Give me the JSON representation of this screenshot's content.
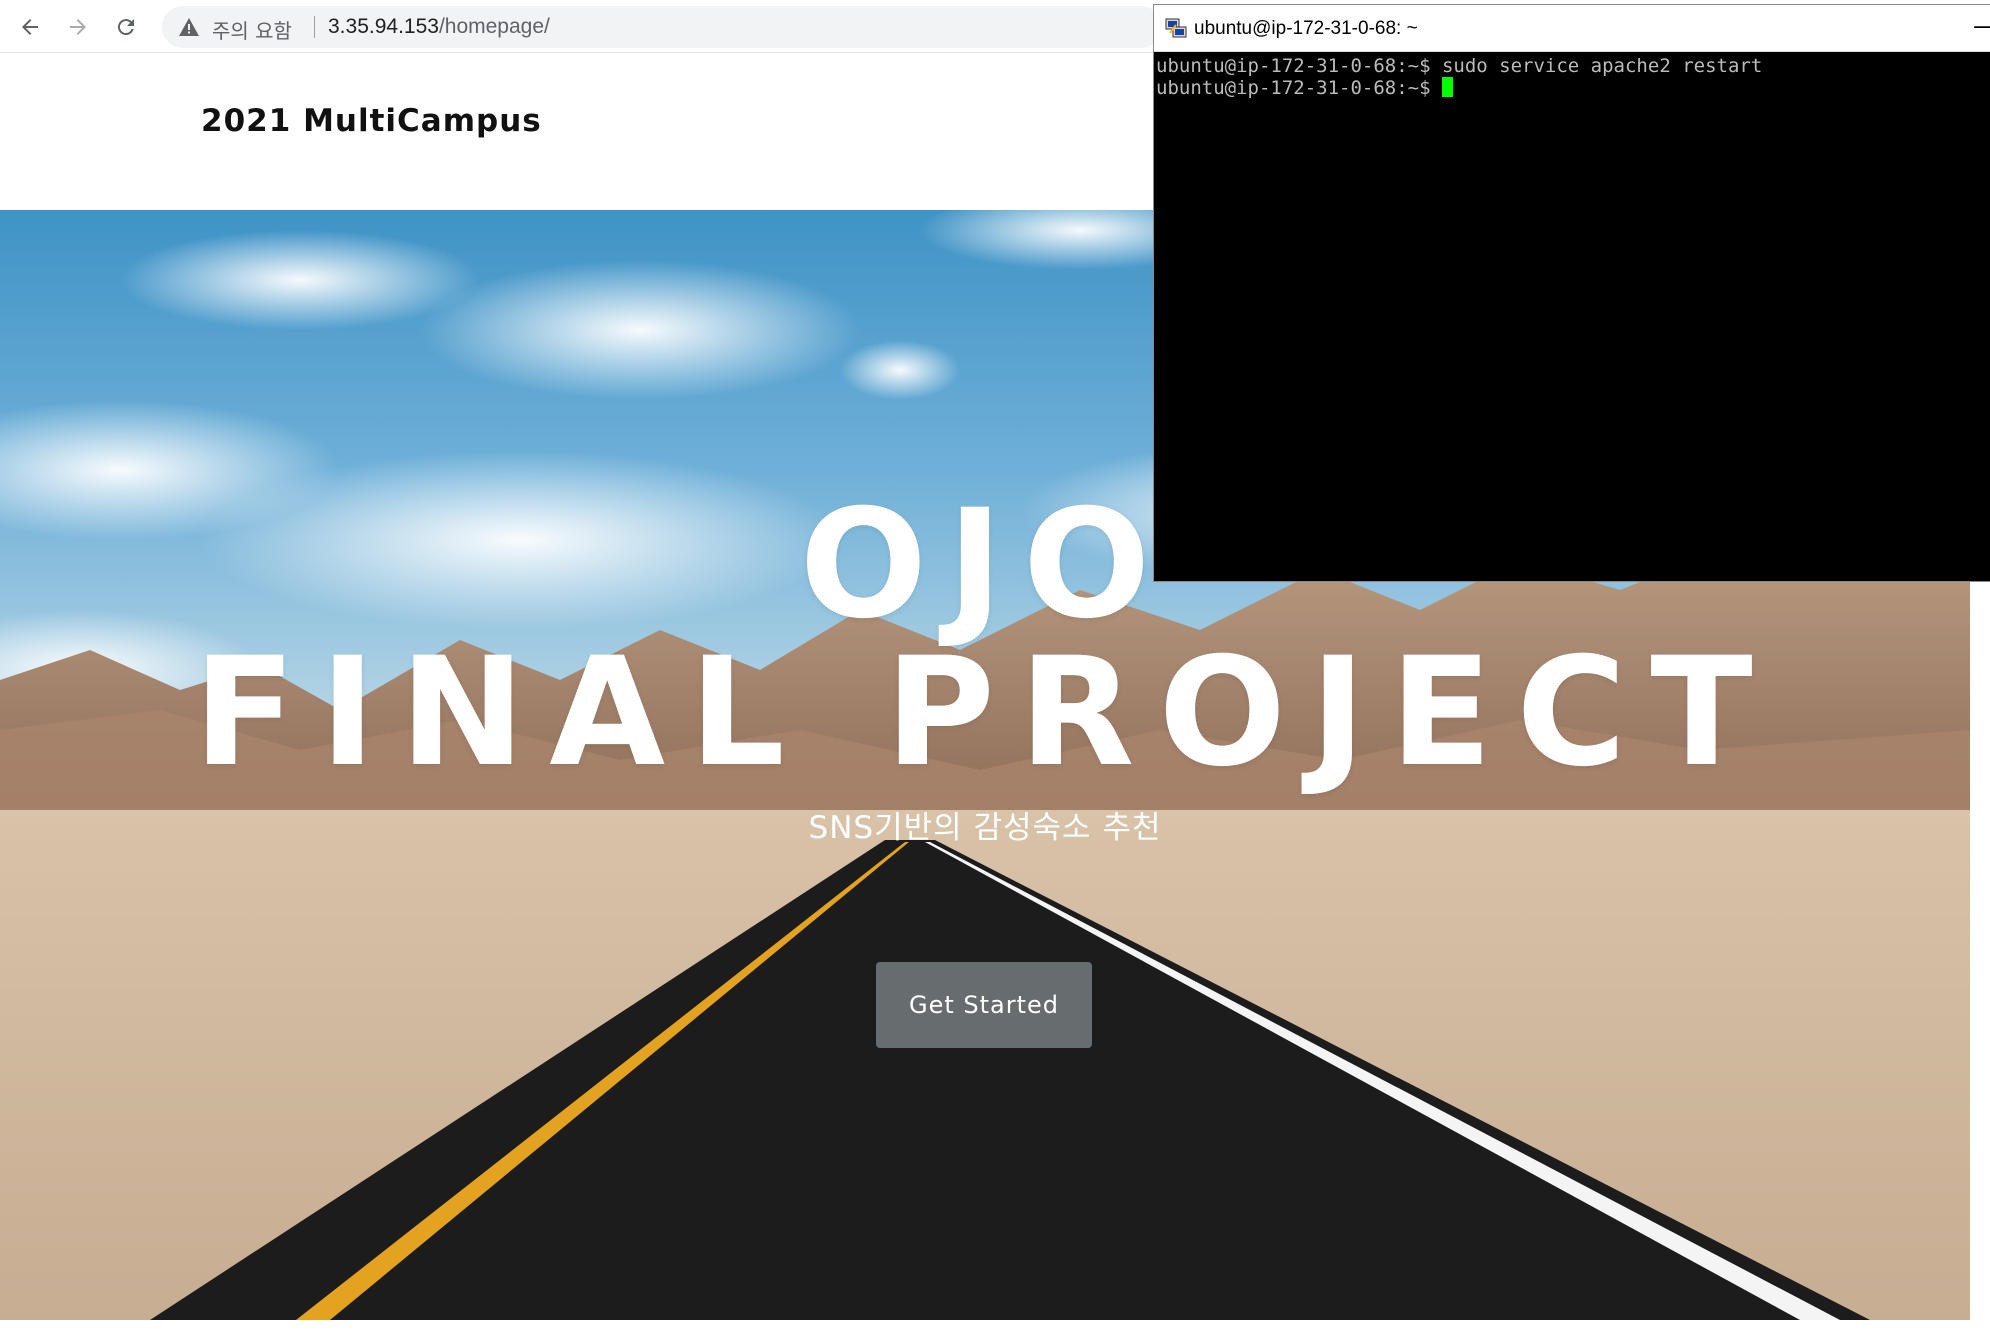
{
  "browser": {
    "security_label": "주의 요함",
    "url_host": "3.35.94.153",
    "url_path": "/homepage/"
  },
  "site": {
    "brand": "2021 MultiCampus"
  },
  "hero": {
    "title_line1": "OJO",
    "title_line2": "FINAL PROJECT",
    "subtitle": "SNS기반의 감성숙소 추천",
    "cta_label": "Get Started"
  },
  "terminal": {
    "title": "ubuntu@ip-172-31-0-68: ~",
    "minimize_glyph": "—",
    "lines": [
      "ubuntu@ip-172-31-0-68:~$ sudo service apache2 restart",
      "ubuntu@ip-172-31-0-68:~$ "
    ]
  },
  "colors": {
    "terminal_bg": "#000000",
    "terminal_text": "#bbbbbb",
    "cursor": "#00ff00",
    "cta_bg": "#6e7376"
  }
}
